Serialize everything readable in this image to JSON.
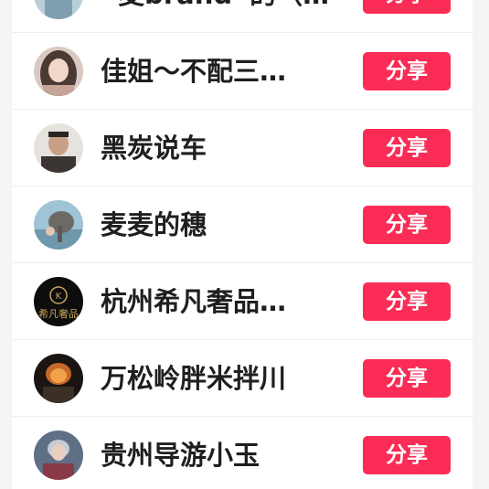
{
  "share_list": {
    "items": [
      {
        "name": "“麦brand”的",
        "suffix": "（…）",
        "action": "分享"
      },
      {
        "name": "佳姐～不配三…",
        "action": "分享"
      },
      {
        "name": "黑炭说车",
        "action": "分享"
      },
      {
        "name": "麦麦的穗",
        "action": "分享"
      },
      {
        "name": "杭州希凡奢品…",
        "action": "分享"
      },
      {
        "name": "万松岭胖米拌川",
        "action": "分享"
      },
      {
        "name": "贵州导游小玉",
        "action": "分享"
      }
    ]
  },
  "avatar_logo_text": "希凡奢品",
  "colors": {
    "share_button": "#fb2c55",
    "background": "#f5f5f7",
    "row": "#ffffff"
  }
}
